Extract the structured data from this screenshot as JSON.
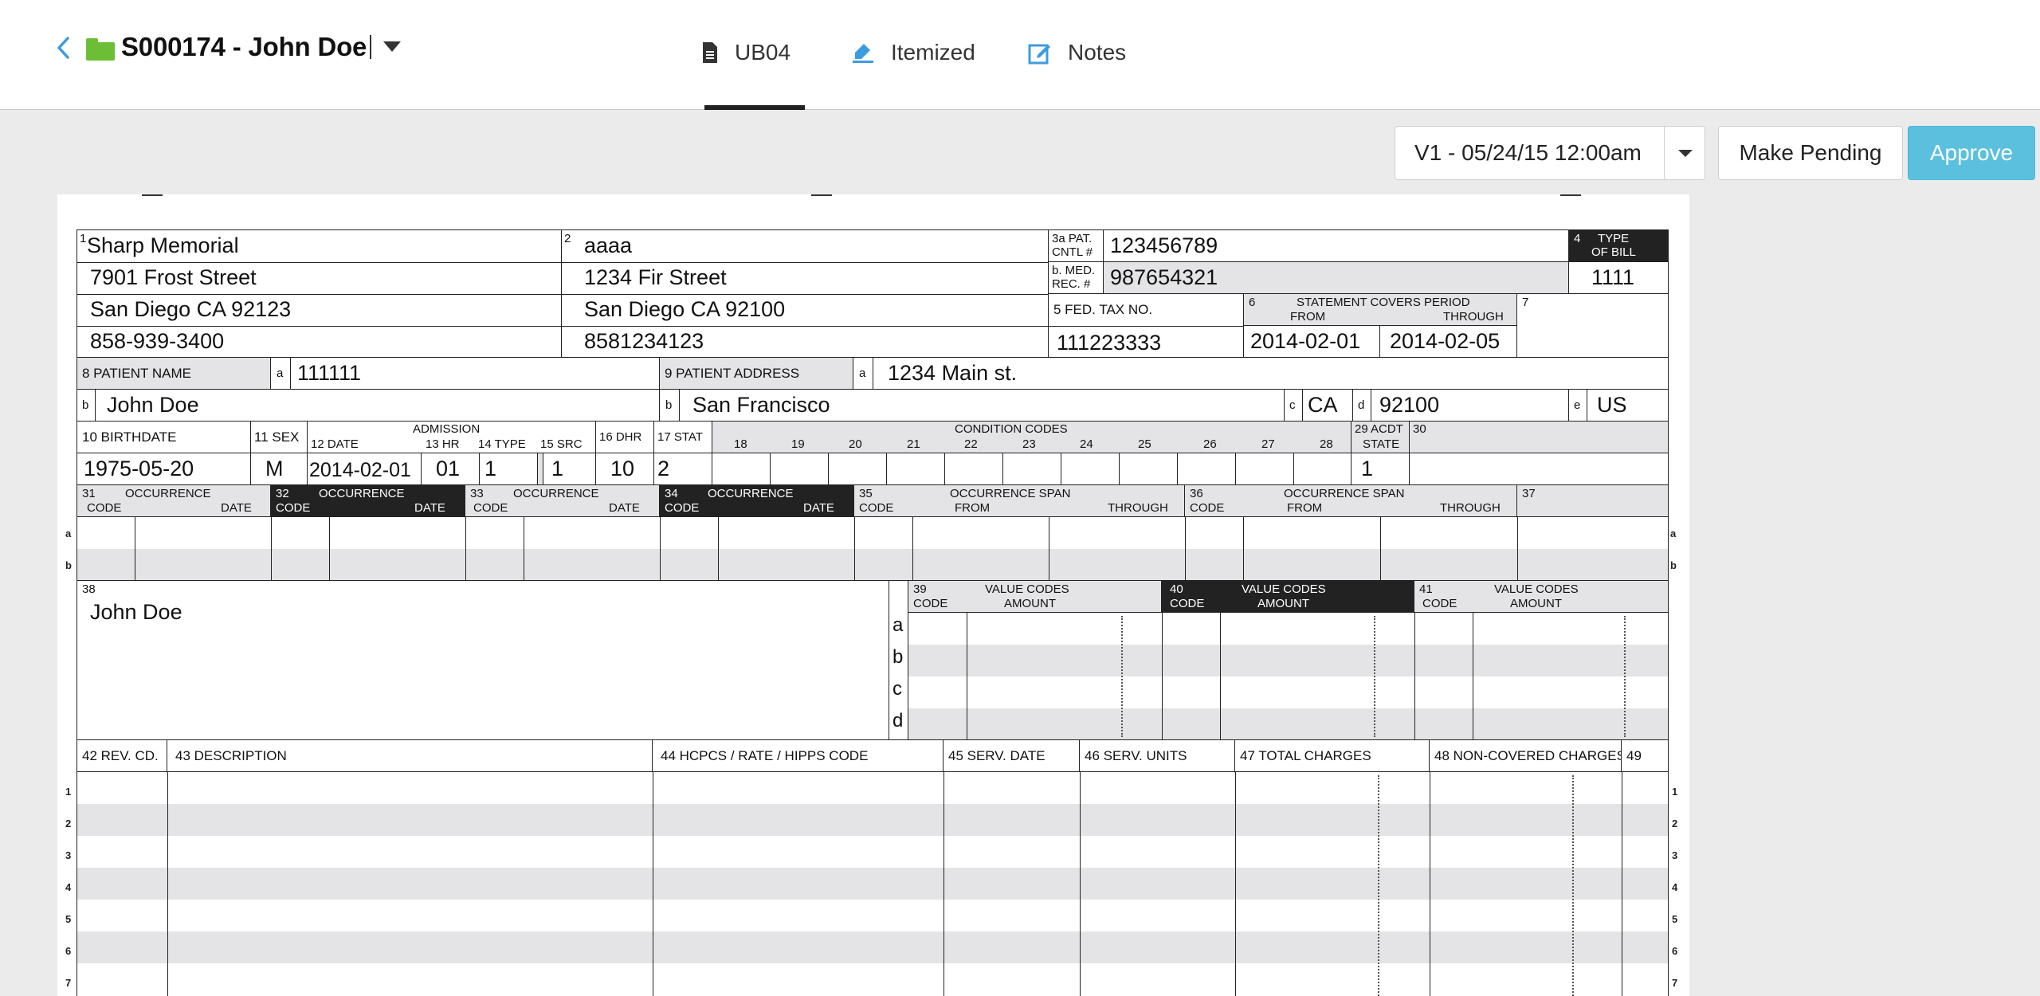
{
  "header": {
    "case_title": "S000174 - John Doe",
    "tabs": [
      {
        "label": "UB04",
        "icon": "document-icon",
        "active": true
      },
      {
        "label": "Itemized",
        "icon": "highlighter-icon",
        "active": false
      },
      {
        "label": "Notes",
        "icon": "edit-note-icon",
        "active": false
      }
    ]
  },
  "toolbar": {
    "version": "V1 - 05/24/15 12:00am",
    "make_pending": "Make Pending",
    "approve": "Approve"
  },
  "colors": {
    "accent": "#3d9be0",
    "approve": "#5bc0de",
    "folder": "#6cbf35",
    "shade": "#e4e4e6"
  },
  "form": {
    "f1": {
      "num": "1",
      "lines": [
        "Sharp Memorial",
        "7901 Frost Street",
        "San Diego CA 92123",
        "858-939-3400"
      ]
    },
    "f2": {
      "num": "2",
      "lines": [
        "aaaa",
        "1234 Fir Street",
        "San Diego CA 92100",
        "8581234123"
      ]
    },
    "f3a": {
      "label1": "3a PAT.",
      "label2": "CNTL #",
      "value": "123456789"
    },
    "f3b": {
      "label1": "b. MED.",
      "label2": "REC. #",
      "value": "987654321"
    },
    "f4": {
      "num": "4",
      "label1": "TYPE",
      "label2": "OF BILL",
      "value": "1111"
    },
    "f5": {
      "label": "5 FED. TAX NO.",
      "value": "111223333"
    },
    "f6": {
      "num": "6",
      "label": "STATEMENT  COVERS PERIOD",
      "from": "FROM",
      "through": "THROUGH",
      "from_value": "2014-02-01",
      "through_value": "2014-02-05"
    },
    "f7": {
      "num": "7"
    },
    "f8": {
      "label": "8 PATIENT  NAME",
      "a": "a",
      "a_value": "111111",
      "b": "b",
      "b_value": "John Doe"
    },
    "f9": {
      "label": "9 PATIENT  ADDRESS",
      "a": "a",
      "a_value": "1234 Main st.",
      "b": "b",
      "b_value": "San Francisco",
      "c": "c",
      "c_value": "CA",
      "d": "d",
      "d_value": "92100",
      "e": "e",
      "e_value": "US"
    },
    "row10": {
      "birthdate_label": "10 BIRTHDATE",
      "birthdate": "1975-05-20",
      "sex_label": "11 SEX",
      "sex": "M",
      "admission_label": "ADMISSION",
      "date_label": "12    DATE",
      "date": "2014-02-01",
      "hr_label": "13 HR",
      "hr": "01",
      "type_label": "14 TYPE",
      "type": "1",
      "src_label": "15 SRC",
      "src": "1",
      "dhr_label": "16 DHR",
      "dhr": "10",
      "stat_label": "17 STAT",
      "stat": "2",
      "condition_label": "CONDITION CODES",
      "condition_numbers": [
        "18",
        "19",
        "20",
        "21",
        "22",
        "23",
        "24",
        "25",
        "26",
        "27",
        "28"
      ],
      "acdt_label1": "29 ACDT",
      "acdt_label2": "STATE",
      "acdt": "1",
      "f30": "30"
    },
    "occurrence": {
      "f31": {
        "num": "31",
        "title": "OCCURRENCE",
        "code": "CODE",
        "date": "DATE"
      },
      "f32": {
        "num": "32",
        "title": "OCCURRENCE",
        "code": "CODE",
        "date": "DATE"
      },
      "f33": {
        "num": "33",
        "title": "OCCURRENCE",
        "code": "CODE",
        "date": "DATE"
      },
      "f34": {
        "num": "34",
        "title": "OCCURRENCE",
        "code": "CODE",
        "date": "DATE"
      },
      "f35": {
        "num": "35",
        "title": "OCCURRENCE SPAN",
        "code": "CODE",
        "from": "FROM",
        "through": "THROUGH"
      },
      "f36": {
        "num": "36",
        "title": "OCCURRENCE SPAN",
        "code": "CODE",
        "from": "FROM",
        "through": "THROUGH"
      },
      "f37": {
        "num": "37"
      },
      "rows": [
        "a",
        "b"
      ]
    },
    "f38": {
      "num": "38",
      "value": "John Doe"
    },
    "value_codes": {
      "f39": {
        "num": "39",
        "title": "VALUE CODES",
        "code": "CODE",
        "amount": "AMOUNT"
      },
      "f40": {
        "num": "40",
        "title": "VALUE CODES",
        "code": "CODE",
        "amount": "AMOUNT"
      },
      "f41": {
        "num": "41",
        "title": "VALUE CODES",
        "code": "CODE",
        "amount": "AMOUNT"
      },
      "rows": [
        "a",
        "b",
        "c",
        "d"
      ]
    },
    "lines": {
      "headers": [
        "42 REV. CD.",
        "43 DESCRIPTION",
        "44 HCPCS / RATE / HIPPS CODE",
        "45 SERV. DATE",
        "46 SERV. UNITS",
        "47 TOTAL CHARGES",
        "48 NON-COVERED CHARGES",
        "49"
      ],
      "rows": [
        "1",
        "2",
        "3",
        "4",
        "5",
        "6",
        "7"
      ]
    }
  }
}
